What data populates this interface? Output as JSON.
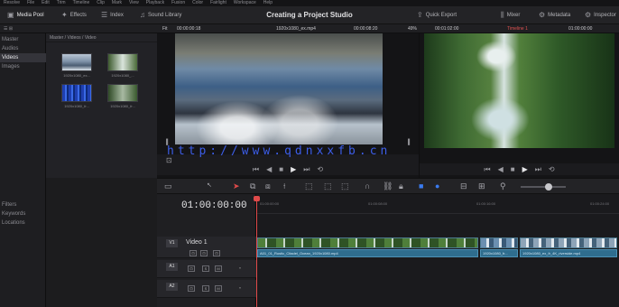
{
  "menu": [
    "Resolve",
    "File",
    "Edit",
    "Trim",
    "Timeline",
    "Clip",
    "Mark",
    "View",
    "Playback",
    "Fusion",
    "Color",
    "Fairlight",
    "Workspace",
    "Help"
  ],
  "toolbar": {
    "media_pool": "Media Pool",
    "effects": "Effects",
    "index": "Index",
    "sound_library": "Sound Library",
    "project_title": "Creating a Project Studio",
    "quick_export": "Quick Export",
    "mixer": "Mixer",
    "metadata": "Metadata",
    "inspector": "Inspector"
  },
  "subbar": {
    "source_zoom": "Fit",
    "source_timecode": "00:00:00:18",
    "clip_name": "1920x1080_ex.mp4",
    "clip_duration": "00:00:08:20",
    "zoom_pct": "49%",
    "record_duration": "00:01:02:00",
    "timeline_name": "Timeline 1",
    "record_timecode": "01:00:00:00"
  },
  "sidebar": {
    "items": [
      "Master",
      "Audios",
      "Videos",
      "Images"
    ],
    "selected": "Videos",
    "lower_items": [
      "Filters",
      "Keywords",
      "Locations"
    ]
  },
  "media": {
    "breadcrumb": "Master / Videos / Video",
    "clips": [
      "1920x1080_ex...",
      "1920x1080_...",
      "1920x1080_fr...",
      "1920x1080_fr..."
    ]
  },
  "timeline": {
    "timecode": "01:00:00:00",
    "tracks": [
      {
        "id": "V1",
        "name": "Video 1"
      },
      {
        "id": "A1",
        "name": ""
      },
      {
        "id": "A2",
        "name": ""
      }
    ],
    "ruler": [
      "01:00:00:00",
      "01:00:08:00",
      "01:00:16:00",
      "01:00:24:00",
      "01:00:32:00"
    ],
    "audio_clips": [
      "A01_01_Rustic_Citadel_Ocean_1920x1080.mp4",
      "1920x1080_fr...",
      "1920x1080_ex_fr_4K_riverside.mp4"
    ]
  },
  "watermark": "http://www.qdnxxfb.cn",
  "colors": {
    "accent_red": "#e04a4a",
    "accent_blue": "#3a7bf0",
    "audio_clip": "#2f6d8e"
  }
}
